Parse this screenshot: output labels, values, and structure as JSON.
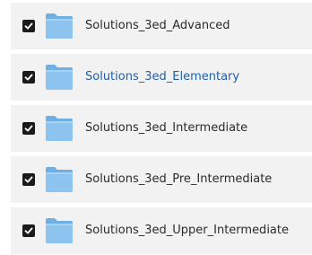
{
  "folders": [
    {
      "name": "Solutions_3ed_Advanced",
      "checked": true,
      "highlighted": false
    },
    {
      "name": "Solutions_3ed_Elementary",
      "checked": true,
      "highlighted": true
    },
    {
      "name": "Solutions_3ed_Intermediate",
      "checked": true,
      "highlighted": false
    },
    {
      "name": "Solutions_3ed_Pre_Intermediate",
      "checked": true,
      "highlighted": false
    },
    {
      "name": "Solutions_3ed_Upper_Intermediate",
      "checked": true,
      "highlighted": false
    }
  ],
  "icons": {
    "checkbox": "checkbox-checked-icon",
    "folder": "folder-icon"
  },
  "colors": {
    "row_background": "#f2f2f2",
    "checkbox_fill": "#1a1a1a",
    "folder_blue": "#8cc4ef",
    "text": "#2b2b2b",
    "highlight_text": "#1f5fa8"
  }
}
